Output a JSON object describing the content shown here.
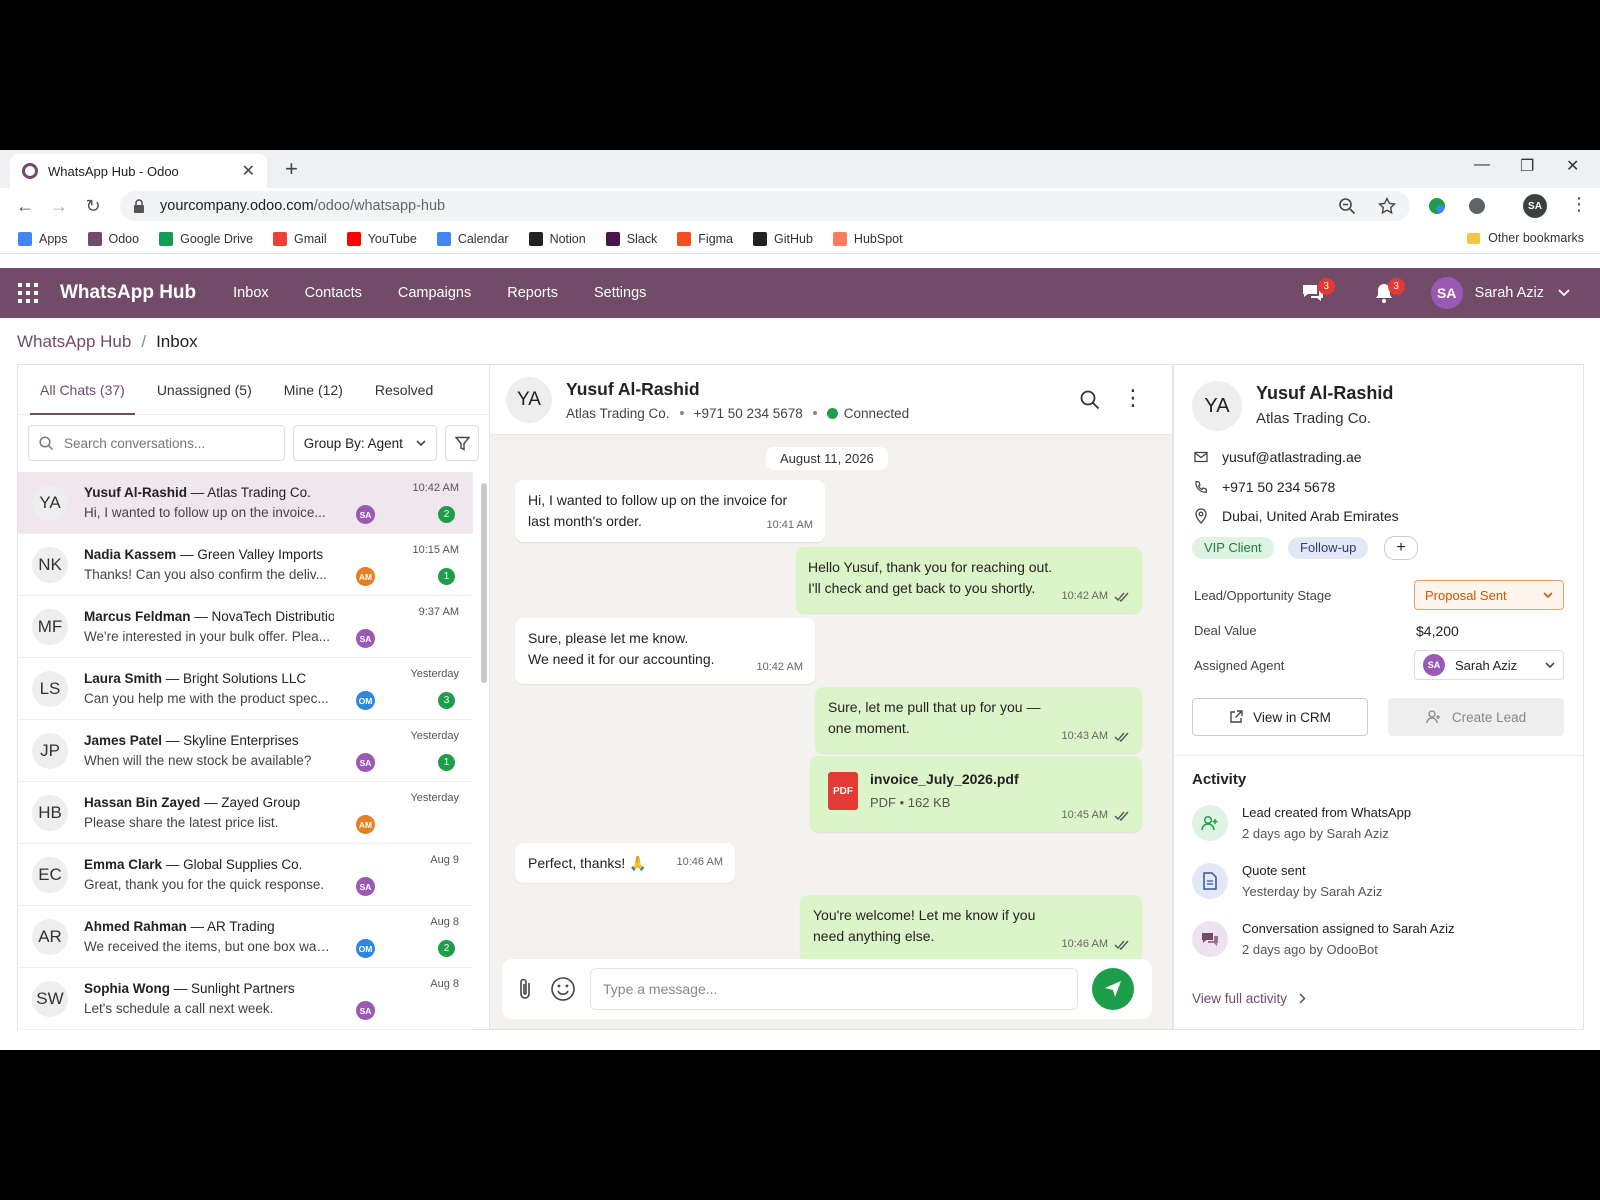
{
  "browser": {
    "tab_title": "WhatsApp Hub - Odoo",
    "url_domain": "yourcompany.odoo.com",
    "url_path": "/odoo/whatsapp-hub",
    "profile_initials": "SA",
    "bookmarks": [
      {
        "label": "Apps",
        "color": "#4285f4"
      },
      {
        "label": "Odoo",
        "color": "#714b67"
      },
      {
        "label": "Google Drive",
        "color": "#0f9d58"
      },
      {
        "label": "Gmail",
        "color": "#ea4335"
      },
      {
        "label": "YouTube",
        "color": "#ff0000"
      },
      {
        "label": "Calendar",
        "color": "#4285f4"
      },
      {
        "label": "Notion",
        "color": "#222222"
      },
      {
        "label": "Slack",
        "color": "#4a154b"
      },
      {
        "label": "Figma",
        "color": "#f24e1e"
      },
      {
        "label": "GitHub",
        "color": "#222222"
      },
      {
        "label": "HubSpot",
        "color": "#ff7a59"
      }
    ],
    "other_bookmarks": "Other bookmarks"
  },
  "app": {
    "title": "WhatsApp Hub",
    "menu": [
      "Inbox",
      "Contacts",
      "Campaigns",
      "Reports",
      "Settings"
    ],
    "chat_badge": "3",
    "notif_badge": "3",
    "user_initials": "SA",
    "user_name": "Sarah Aziz",
    "accent": "#714b67"
  },
  "breadcrumb": {
    "root": "WhatsApp Hub",
    "sep": "/",
    "current": "Inbox"
  },
  "inbox": {
    "tabs": [
      "All Chats (37)",
      "Unassigned (5)",
      "Mine (12)",
      "Resolved"
    ],
    "search_placeholder": "Search conversations...",
    "group_by": "Group By: Agent",
    "conversations": [
      {
        "initials": "YA",
        "name": "Yusuf Al-Rashid",
        "company": "— Atlas Trading Co.",
        "preview": "Hi, I wanted to follow up on the invoice...",
        "time": "10:42 AM",
        "agent": "SA",
        "agent_color": "#9b59b6",
        "unread": "2",
        "selected": true
      },
      {
        "initials": "NK",
        "name": "Nadia Kassem",
        "company": "— Green Valley Imports",
        "preview": "Thanks! Can you also confirm the deliv...",
        "time": "10:15 AM",
        "agent": "AM",
        "agent_color": "#e67e22",
        "unread": "1"
      },
      {
        "initials": "MF",
        "name": "Marcus Feldman",
        "company": "— NovaTech Distribution",
        "preview": "We're interested in your bulk offer. Plea...",
        "time": "9:37 AM",
        "agent": "SA",
        "agent_color": "#9b59b6",
        "unread": ""
      },
      {
        "initials": "LS",
        "name": "Laura Smith",
        "company": "— Bright Solutions LLC",
        "preview": "Can you help me with the product spec...",
        "time": "Yesterday",
        "agent": "OM",
        "agent_color": "#2e86de",
        "unread": "3"
      },
      {
        "initials": "JP",
        "name": "James Patel",
        "company": "— Skyline Enterprises",
        "preview": "When will the new stock be available?",
        "time": "Yesterday",
        "agent": "SA",
        "agent_color": "#9b59b6",
        "unread": "1"
      },
      {
        "initials": "HB",
        "name": "Hassan Bin Zayed",
        "company": "— Zayed Group",
        "preview": "Please share the latest price list.",
        "time": "Yesterday",
        "agent": "AM",
        "agent_color": "#e67e22",
        "unread": ""
      },
      {
        "initials": "EC",
        "name": "Emma Clark",
        "company": "— Global Supplies Co.",
        "preview": "Great, thank you for the quick response.",
        "time": "Aug 9",
        "agent": "SA",
        "agent_color": "#9b59b6",
        "unread": ""
      },
      {
        "initials": "AR",
        "name": "Ahmed Rahman",
        "company": "— AR Trading",
        "preview": "We received the items, but one box was...",
        "time": "Aug 8",
        "agent": "OM",
        "agent_color": "#2e86de",
        "unread": "2"
      },
      {
        "initials": "SW",
        "name": "Sophia Wong",
        "company": "— Sunlight Partners",
        "preview": "Let's schedule a call next week.",
        "time": "Aug 8",
        "agent": "SA",
        "agent_color": "#9b59b6",
        "unread": ""
      }
    ]
  },
  "chat": {
    "initials": "YA",
    "name": "Yusuf Al-Rashid",
    "company": "Atlas Trading Co.",
    "phone": "+971 50 234 5678",
    "status": "Connected",
    "date": "August 11, 2026",
    "messages": {
      "m1": {
        "text1": "Hi, I wanted to follow up on the invoice for",
        "text2": "last month's order.",
        "time": "10:41 AM"
      },
      "m2": {
        "text1": "Hello Yusuf, thank you for reaching out.",
        "text2": "I'll check and get back to you shortly.",
        "time": "10:42 AM"
      },
      "m3": {
        "text1": "Sure, please let me know.",
        "text2": "We need it for our accounting.",
        "time": "10:42 AM"
      },
      "m4": {
        "text1": "Sure, let me pull that up for you —",
        "text2": "one moment.",
        "time": "10:43 AM"
      },
      "m5": {
        "file": "invoice_July_2026.pdf",
        "meta": "PDF • 162 KB",
        "icon": "PDF",
        "time": "10:45 AM"
      },
      "m6": {
        "text1": "Perfect, thanks! 🙏",
        "time": "10:46 AM"
      },
      "m7": {
        "text1": "You're welcome! Let me know if you",
        "text2": "need anything else.",
        "time": "10:46 AM"
      }
    },
    "composer_placeholder": "Type a message..."
  },
  "contact": {
    "initials": "YA",
    "name": "Yusuf Al-Rashid",
    "company": "Atlas Trading Co.",
    "email": "yusuf@atlastrading.ae",
    "phone": "+971 50 234 5678",
    "location": "Dubai, United Arab Emirates",
    "tags": [
      "VIP Client",
      "Follow-up"
    ],
    "add_tag": "+",
    "stage_label": "Lead/Opportunity Stage",
    "stage_value": "Proposal Sent",
    "deal_label": "Deal Value",
    "deal_value": "$4,200",
    "agent_label": "Assigned Agent",
    "agent_initials": "SA",
    "agent_value": "Sarah Aziz",
    "view_crm": "View in CRM",
    "create_lead": "Create Lead",
    "activity_title": "Activity",
    "activities": [
      {
        "title": "Lead created from WhatsApp",
        "sub": "2 days ago by Sarah Aziz"
      },
      {
        "title": "Quote sent",
        "sub": "Yesterday by Sarah Aziz"
      },
      {
        "title": "Conversation assigned to Sarah Aziz",
        "sub": "2 days ago by OdooBot"
      }
    ],
    "view_full": "View full activity"
  }
}
